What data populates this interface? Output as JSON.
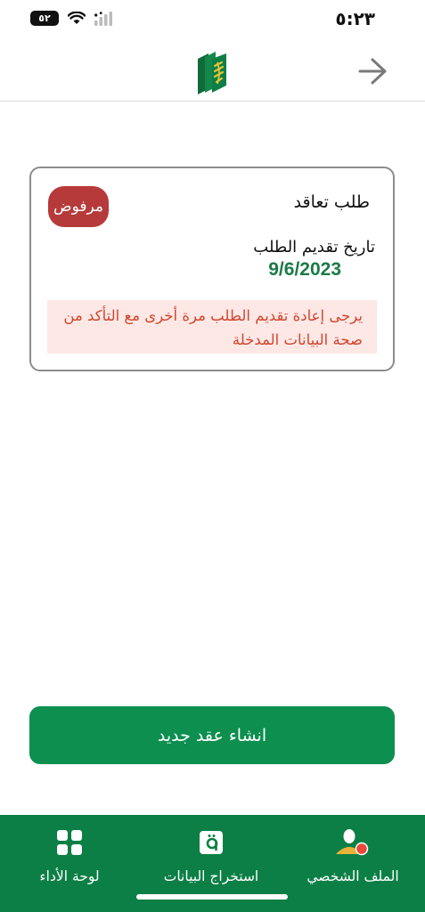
{
  "status_bar": {
    "time": "٥:٢٣",
    "battery": "٥٢"
  },
  "header": {
    "logo_icon": "bank-logo-icon",
    "back_icon": "arrow-right-icon"
  },
  "card": {
    "title": "طلب تعاقد",
    "status": "مرفوض",
    "date_label": "تاريخ تقديم الطلب",
    "date_value": "9/6/2023",
    "notice": "يرجى إعادة تقديم الطلب مرة أخرى مع التأكد من صحة البيانات المدخلة"
  },
  "primary_button": {
    "label": "انشاء عقد جديد"
  },
  "bottom_nav": {
    "items": [
      {
        "label": "الملف الشخصي",
        "icon": "profile-icon"
      },
      {
        "label": "استخراج البيانات",
        "icon": "extract-data-icon"
      },
      {
        "label": "لوحة الأداء",
        "icon": "dashboard-grid-icon"
      }
    ]
  },
  "colors": {
    "brand_green": "#0c8f4f",
    "nav_green": "#0b7f45",
    "date_green": "#1c7a47",
    "rejected_red": "#b63a3a",
    "notice_text": "#d0472f",
    "notice_bg": "#fde8e6"
  }
}
